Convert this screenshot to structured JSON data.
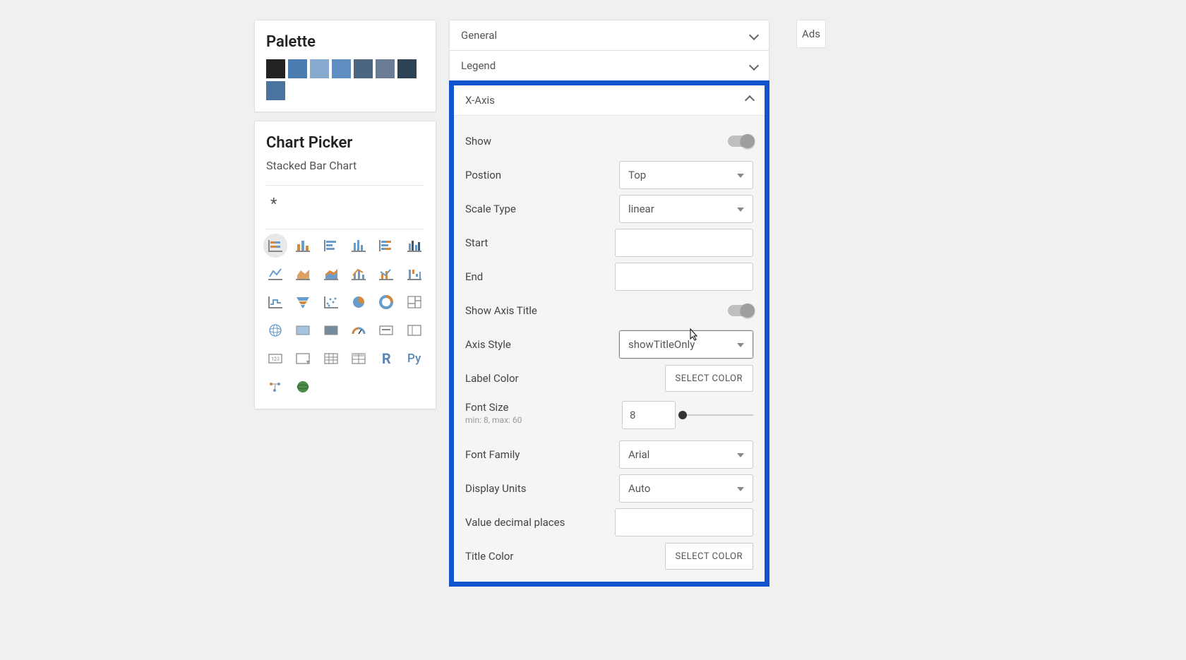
{
  "palette": {
    "title": "Palette",
    "colors": [
      "#222222",
      "#4a7cb0",
      "#87abce",
      "#5e8fc0",
      "#4d6680",
      "#6a7d94",
      "#2e4256",
      "#4a739f"
    ]
  },
  "chart_picker": {
    "title": "Chart Picker",
    "subtitle": "Stacked Bar Chart",
    "asterisk": "*"
  },
  "settings": {
    "general": "General",
    "legend": "Legend",
    "xaxis_title": "X-Axis",
    "rows": {
      "show": "Show",
      "position": {
        "label": "Postion",
        "value": "Top"
      },
      "scale_type": {
        "label": "Scale Type",
        "value": "linear"
      },
      "start": {
        "label": "Start",
        "value": ""
      },
      "end": {
        "label": "End",
        "value": ""
      },
      "show_axis_title": "Show Axis Title",
      "axis_style": {
        "label": "Axis Style",
        "value": "showTitleOnly"
      },
      "label_color": {
        "label": "Label Color",
        "button": "Select Color"
      },
      "font_size": {
        "label": "Font Size",
        "hint": "min: 8, max: 60",
        "value": "8"
      },
      "font_family": {
        "label": "Font Family",
        "value": "Arial"
      },
      "display_units": {
        "label": "Display Units",
        "value": "Auto"
      },
      "decimal_places": {
        "label": "Value decimal places",
        "value": ""
      },
      "title_color": {
        "label": "Title Color",
        "button": "Select Color"
      }
    }
  },
  "ads": "Ads"
}
